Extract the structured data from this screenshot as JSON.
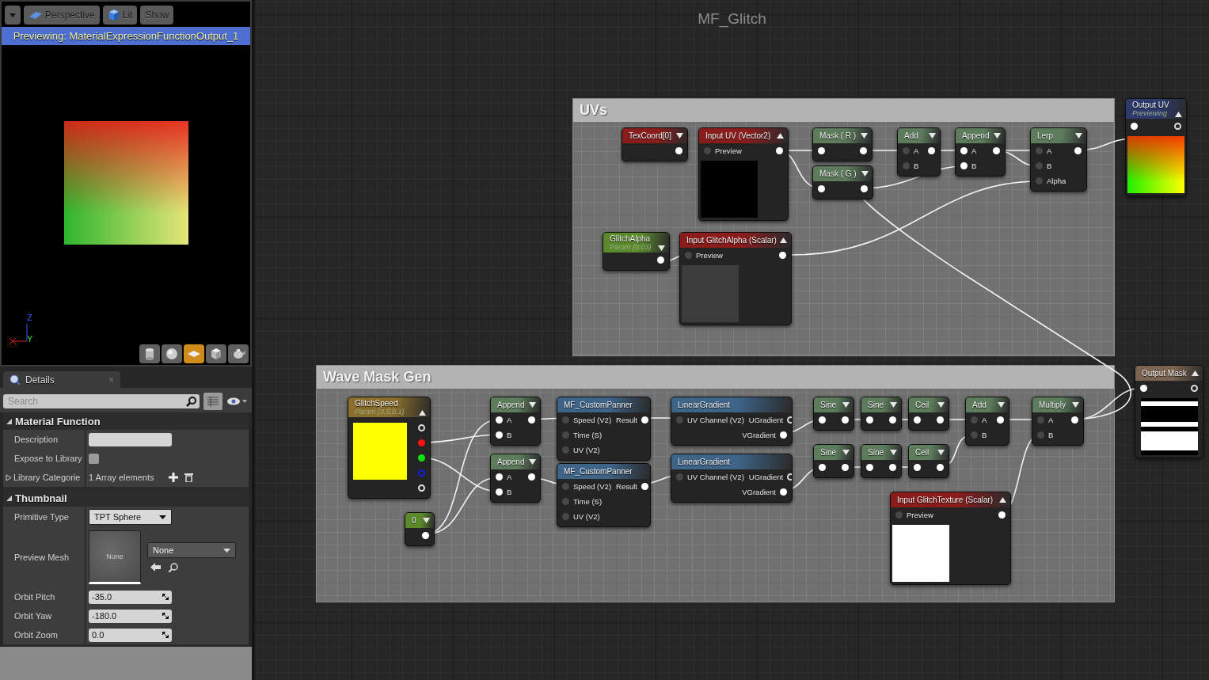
{
  "viewport": {
    "toolbar": [
      {
        "kind": "menu"
      },
      {
        "kind": "view",
        "label": "Perspective"
      },
      {
        "kind": "lighting",
        "label": "Lit"
      },
      {
        "kind": "plain",
        "label": "Show"
      }
    ],
    "previewing": "Previewing: MaterialExpressionFunctionOutput_1",
    "axes": {
      "up": "Z",
      "right": "Y"
    },
    "shape_buttons": [
      {
        "kind": "cylinder",
        "selected": false
      },
      {
        "kind": "sphere",
        "selected": false
      },
      {
        "kind": "plane",
        "selected": true
      },
      {
        "kind": "cube",
        "selected": false
      },
      {
        "kind": "teapot",
        "selected": false
      }
    ]
  },
  "details": {
    "tab": {
      "label": "Details",
      "close": "×"
    },
    "search": {
      "placeholder": "Search"
    },
    "sections": [
      {
        "title": "Material Function",
        "expanded": true,
        "rows": [
          {
            "kind": "text",
            "label": "Description"
          },
          {
            "kind": "checkbox",
            "label": "Expose to Library",
            "checked": false
          },
          {
            "kind": "array",
            "label": "Library Categorie",
            "expanded": false,
            "value": "1 Array elements"
          }
        ]
      },
      {
        "title": "Thumbnail",
        "expanded": true,
        "rows": [
          {
            "kind": "dropdown",
            "label": "Primitive Type",
            "value": "TPT Sphere"
          },
          {
            "kind": "asset",
            "label": "Preview Mesh",
            "thumbnail": "None",
            "value": "None"
          },
          {
            "kind": "number",
            "label": "Orbit Pitch",
            "value": "-35.0"
          },
          {
            "kind": "number",
            "label": "Orbit Yaw",
            "value": "-180.0"
          },
          {
            "kind": "number",
            "label": "Orbit Zoom",
            "value": "0.0"
          }
        ]
      }
    ]
  },
  "graph": {
    "title": "MF_Glitch",
    "comments": [
      {
        "title": "UVs"
      },
      {
        "title": "Wave Mask Gen"
      }
    ],
    "nodes": [
      {
        "title": "TexCoord[0]",
        "color": "#8a1c1c",
        "expanded": false,
        "rows": [
          {
            "out": {
              "linked": true
            }
          }
        ]
      },
      {
        "title": "Input UV (Vector2)",
        "color": "#8a1c1c",
        "expanded": true,
        "preview": {
          "kind": "solid",
          "color": "#000000"
        },
        "rows": [
          {
            "in": {
              "label": "Preview",
              "linked": false
            },
            "out": {
              "linked": true
            }
          }
        ]
      },
      {
        "title": "Mask ( R )",
        "color": "#5c7c5c",
        "expanded": false,
        "rows": [
          {
            "in": {
              "linked": true
            },
            "out": {
              "linked": true
            }
          }
        ]
      },
      {
        "title": "Mask ( G )",
        "color": "#5c7c5c",
        "expanded": false,
        "rows": [
          {
            "in": {
              "linked": true
            },
            "out": {
              "linked": true
            }
          }
        ]
      },
      {
        "title": "Add",
        "color": "#5c7c5c",
        "expanded": false,
        "rows": [
          {
            "in": {
              "label": "A",
              "linked": false
            },
            "out": {
              "linked": true
            }
          },
          {
            "in": {
              "label": "B",
              "linked": false
            }
          }
        ]
      },
      {
        "title": "Append",
        "color": "#5c7c5c",
        "expanded": false,
        "rows": [
          {
            "in": {
              "label": "A",
              "linked": true
            },
            "out": {
              "linked": true
            }
          },
          {
            "in": {
              "label": "B",
              "linked": true
            }
          }
        ]
      },
      {
        "title": "Lerp",
        "color": "#5c7c5c",
        "expanded": false,
        "rows": [
          {
            "in": {
              "label": "A",
              "linked": false
            },
            "out": {
              "linked": true
            }
          },
          {
            "in": {
              "label": "B",
              "linked": false
            }
          },
          {
            "in": {
              "label": "Alpha",
              "linked": false
            }
          }
        ]
      },
      {
        "title": "GlitchAlpha",
        "subtitle": "Param (0.03)",
        "color": "#5a8a2c",
        "expanded": false,
        "rows": [
          {
            "out": {
              "linked": true
            }
          }
        ]
      },
      {
        "title": "Input GlitchAlpha (Scalar)",
        "color": "#8a1c1c",
        "expanded": true,
        "preview": {
          "kind": "solid",
          "color": "#3c3c3c"
        },
        "rows": [
          {
            "in": {
              "label": "Preview",
              "linked": false
            },
            "out": {
              "linked": true
            }
          }
        ]
      },
      {
        "title": "Output UV",
        "subtitle": "Previewing",
        "color": "#2c3a6c",
        "expanded": true,
        "preview": {
          "kind": "gradient"
        },
        "rows": [
          {
            "in": {
              "linked": true
            },
            "out": {
              "linked": false
            }
          }
        ]
      },
      {
        "title": "GlitchSpeed",
        "subtitle": "Param (3,5,0,1)",
        "color": "#8a6e2c",
        "kind": "vector_param",
        "expanded": true,
        "preview": {
          "kind": "solid",
          "color": "#ffff00"
        },
        "rows": [
          {
            "out": {
              "linked": false
            }
          },
          {
            "out": {
              "linked": true,
              "color": "#ff1010"
            }
          },
          {
            "out": {
              "linked": true,
              "color": "#10e010"
            }
          },
          {
            "out": {
              "linked": false,
              "color": "#1020e0"
            }
          },
          {
            "out": {
              "linked": false
            }
          }
        ]
      },
      {
        "title": "0",
        "color": "#5a8a2c",
        "expanded": false,
        "rows": [
          {
            "out": {
              "linked": true
            }
          }
        ]
      },
      {
        "title": "Append",
        "color": "#5c7c5c",
        "expanded": false,
        "rows": [
          {
            "in": {
              "label": "A",
              "linked": true
            },
            "out": {
              "linked": true
            }
          },
          {
            "in": {
              "label": "B",
              "linked": true
            }
          }
        ]
      },
      {
        "title": "Append",
        "color": "#5c7c5c",
        "expanded": false,
        "rows": [
          {
            "in": {
              "label": "A",
              "linked": true
            },
            "out": {
              "linked": true
            }
          },
          {
            "in": {
              "label": "B",
              "linked": true
            }
          }
        ]
      },
      {
        "title": "MF_CustomPanner",
        "color": "#3e6488",
        "rows": [
          {
            "in": {
              "label": "Speed (V2)",
              "linked": false
            },
            "out": {
              "label": "Result",
              "linked": true
            }
          },
          {
            "in": {
              "label": "Time (S)",
              "linked": false
            }
          },
          {
            "in": {
              "label": "UV (V2)",
              "linked": false
            }
          }
        ]
      },
      {
        "title": "MF_CustomPanner",
        "color": "#3e6488",
        "rows": [
          {
            "in": {
              "label": "Speed (V2)",
              "linked": false
            },
            "out": {
              "label": "Result",
              "linked": true
            }
          },
          {
            "in": {
              "label": "Time (S)",
              "linked": false
            }
          },
          {
            "in": {
              "label": "UV (V2)",
              "linked": false
            }
          }
        ]
      },
      {
        "title": "LinearGradient",
        "color": "#3e6488",
        "rows": [
          {
            "in": {
              "label": "UV Channel (V2)",
              "linked": false
            },
            "out": {
              "label": "UGradient",
              "linked": false
            }
          },
          {
            "out": {
              "label": "VGradient",
              "linked": true
            }
          }
        ]
      },
      {
        "title": "LinearGradient",
        "color": "#3e6488",
        "rows": [
          {
            "in": {
              "label": "UV Channel (V2)",
              "linked": false
            },
            "out": {
              "label": "UGradient",
              "linked": false
            }
          },
          {
            "out": {
              "label": "VGradient",
              "linked": true
            }
          }
        ]
      },
      {
        "title": "Sine",
        "color": "#5c7c5c",
        "expanded": false,
        "rows": [
          {
            "in": {
              "linked": true
            },
            "out": {
              "linked": true
            }
          }
        ]
      },
      {
        "title": "Sine",
        "color": "#5c7c5c",
        "expanded": false,
        "rows": [
          {
            "in": {
              "linked": true
            },
            "out": {
              "linked": true
            }
          }
        ]
      },
      {
        "title": "Ceil",
        "color": "#5c7c5c",
        "expanded": false,
        "rows": [
          {
            "in": {
              "linked": true
            },
            "out": {
              "linked": true
            }
          }
        ]
      },
      {
        "title": "Sine",
        "color": "#5c7c5c",
        "expanded": false,
        "rows": [
          {
            "in": {
              "linked": true
            },
            "out": {
              "linked": true
            }
          }
        ]
      },
      {
        "title": "Sine",
        "color": "#5c7c5c",
        "expanded": false,
        "rows": [
          {
            "in": {
              "linked": true
            },
            "out": {
              "linked": true
            }
          }
        ]
      },
      {
        "title": "Ceil",
        "color": "#5c7c5c",
        "expanded": false,
        "rows": [
          {
            "in": {
              "linked": true
            },
            "out": {
              "linked": true
            }
          }
        ]
      },
      {
        "title": "Add",
        "color": "#5c7c5c",
        "expanded": false,
        "rows": [
          {
            "in": {
              "label": "A",
              "linked": false
            },
            "out": {
              "linked": true
            }
          },
          {
            "in": {
              "label": "B",
              "linked": false
            }
          }
        ]
      },
      {
        "title": "Multiply",
        "color": "#5c7c5c",
        "expanded": false,
        "rows": [
          {
            "in": {
              "label": "A",
              "linked": false
            },
            "out": {
              "linked": true
            }
          },
          {
            "in": {
              "label": "B",
              "linked": false
            }
          }
        ]
      },
      {
        "title": "Input GlitchTexture (Scalar)",
        "color": "#8a1c1c",
        "expanded": true,
        "preview": {
          "kind": "solid",
          "color": "#ffffff"
        },
        "rows": [
          {
            "in": {
              "label": "Preview",
              "linked": false
            },
            "out": {
              "linked": true
            }
          }
        ]
      },
      {
        "title": "Output Mask",
        "color": "#7a6450",
        "expanded": true,
        "preview": {
          "kind": "stripes"
        },
        "rows": [
          {
            "in": {
              "linked": true
            },
            "out": {
              "linked": false
            }
          }
        ]
      }
    ]
  }
}
